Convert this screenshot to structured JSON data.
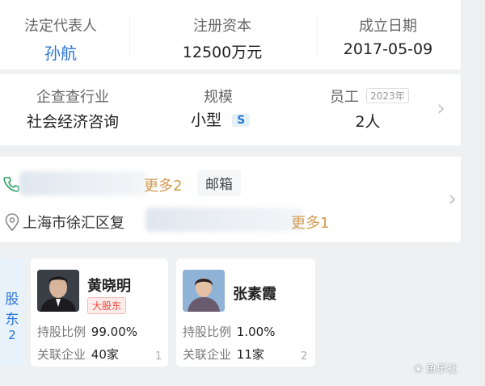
{
  "top_info": {
    "legal_rep_label": "法定代表人",
    "legal_rep_value": "孙航",
    "capital_label": "注册资本",
    "capital_value": "12500万元",
    "established_label": "成立日期",
    "established_value": "2017-05-09"
  },
  "industry_info": {
    "industry_label": "企查查行业",
    "industry_value": "社会经济咨询",
    "scale_label": "规模",
    "scale_value": "小型",
    "scale_badge": "S",
    "staff_label": "员工",
    "staff_year": "2023年",
    "staff_value": "2人"
  },
  "contact": {
    "phone_more": "更多2",
    "email_label": "邮箱",
    "address_prefix": "上海市徐汇区复",
    "address_more": "更多1"
  },
  "shareholders": {
    "side_label_1": "股",
    "side_label_2": "东",
    "count": "2",
    "items": [
      {
        "name": "黄晓明",
        "tag": "大股东",
        "ratio_label": "持股比例",
        "ratio_value": "99.00%",
        "related_label": "关联企业",
        "related_value": "40家",
        "index": "1"
      },
      {
        "name": "张素霞",
        "ratio_label": "持股比例",
        "ratio_value": "1.00%",
        "related_label": "关联企业",
        "related_value": "11家",
        "index": "2"
      }
    ]
  },
  "watermark": "鱼乐社",
  "colors": {
    "link_blue": "#2b74d8",
    "orange": "#d39a52",
    "tag_red": "#e8473c",
    "badge_bg": "#e3f0f8",
    "side_bg": "#e8f2fb"
  }
}
